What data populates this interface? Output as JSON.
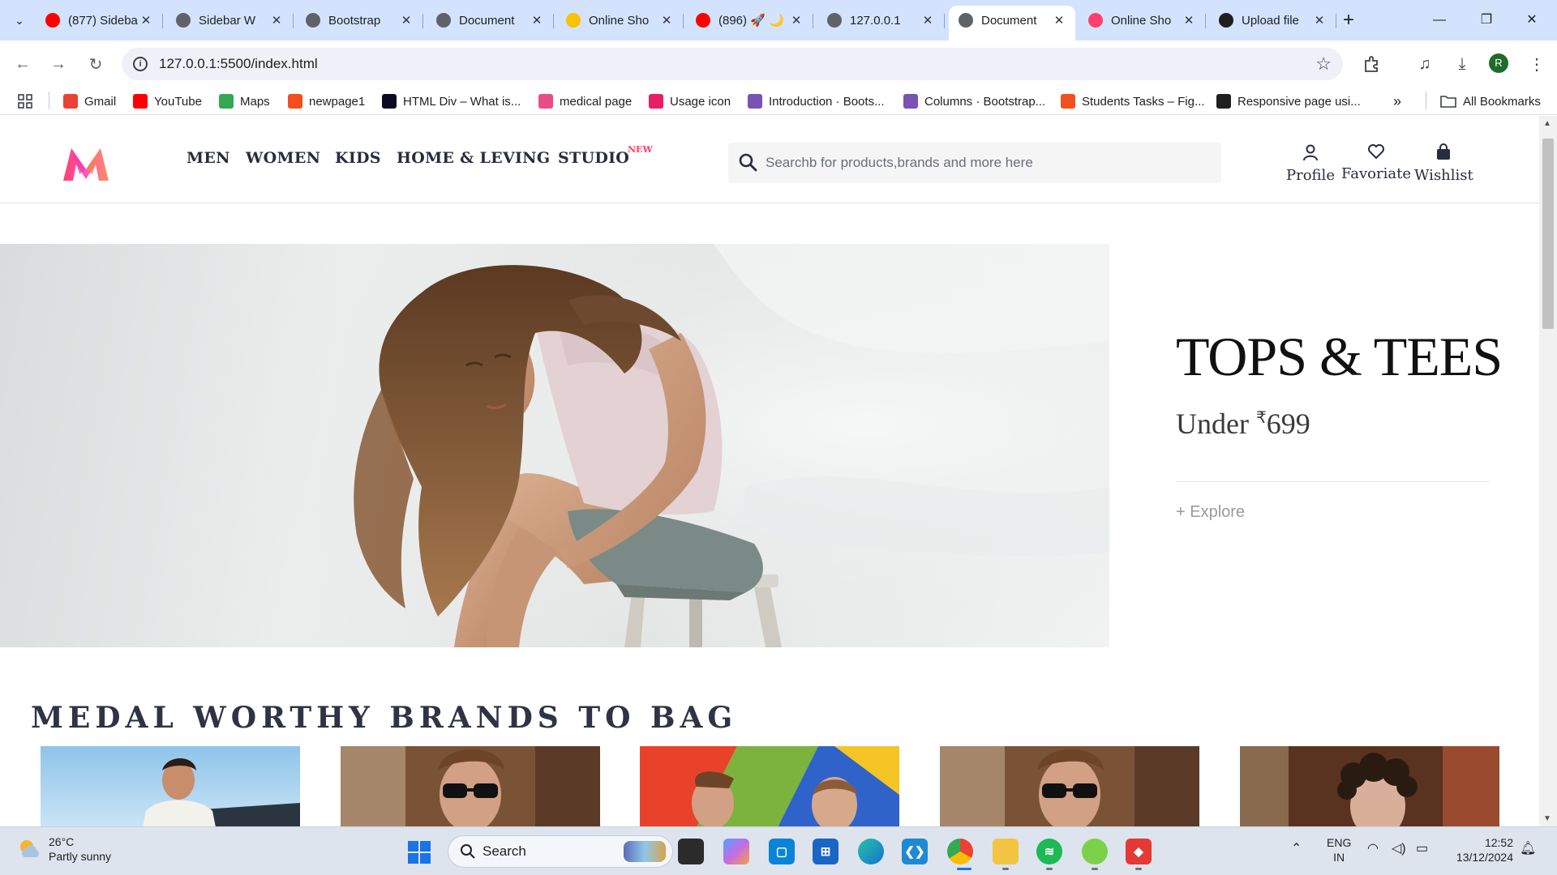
{
  "browser": {
    "tabs": [
      {
        "title": "(877) Sidebar",
        "favicon": "youtube-icon",
        "color": "#ff0000",
        "active": false
      },
      {
        "title": "Sidebar W",
        "favicon": "globe-icon",
        "color": "#5f6368",
        "active": false
      },
      {
        "title": "Bootstrap",
        "favicon": "globe-icon",
        "color": "#5f6368",
        "active": false
      },
      {
        "title": "Document",
        "favicon": "globe-icon",
        "color": "#5f6368",
        "active": false
      },
      {
        "title": "Online Sho",
        "favicon": "flipkart-icon",
        "color": "#f8c200",
        "active": false
      },
      {
        "title": "(896) 🚀 🌙",
        "favicon": "youtube-icon",
        "color": "#ff0000",
        "active": false
      },
      {
        "title": "127.0.0.1",
        "favicon": "globe-icon",
        "color": "#5f6368",
        "active": false
      },
      {
        "title": "Document",
        "favicon": "globe-icon",
        "color": "#5f6368",
        "active": true
      },
      {
        "title": "Online Sho",
        "favicon": "myntra-icon",
        "color": "#ff3f6c",
        "active": false
      },
      {
        "title": "Upload file",
        "favicon": "github-icon",
        "color": "#1f1f1f",
        "active": false
      }
    ],
    "url": "127.0.0.1:5500/index.html",
    "bookmarks": [
      {
        "label": "Gmail",
        "icon": "gmail-icon",
        "color": "#ea4335"
      },
      {
        "label": "YouTube",
        "icon": "youtube-icon",
        "color": "#ff0000"
      },
      {
        "label": "Maps",
        "icon": "maps-icon",
        "color": "#34a853"
      },
      {
        "label": "newpage1",
        "icon": "figma-icon",
        "color": "#f24e1e"
      },
      {
        "label": "HTML Div – What is...",
        "icon": "freecodecamp-icon",
        "color": "#0a0a23"
      },
      {
        "label": "medical page",
        "icon": "dribbble-icon",
        "color": "#ea4c89"
      },
      {
        "label": "Usage icon",
        "icon": "cube-icon",
        "color": "#e91e63"
      },
      {
        "label": "Introduction · Boots...",
        "icon": "bootstrap-icon",
        "color": "#7952b3"
      },
      {
        "label": "Columns · Bootstrap...",
        "icon": "bootstrap-icon",
        "color": "#7952b3"
      },
      {
        "label": "Students Tasks – Fig...",
        "icon": "figma-icon",
        "color": "#f24e1e"
      },
      {
        "label": "Responsive page usi...",
        "icon": "github-icon",
        "color": "#1f1f1f"
      }
    ],
    "all_bookmarks": "All Bookmarks"
  },
  "site": {
    "nav": [
      {
        "label": "MEN"
      },
      {
        "label": "WOMEN"
      },
      {
        "label": "KIDS"
      },
      {
        "label": "HOME & LEVING"
      },
      {
        "label": "STUDIO"
      }
    ],
    "new_tag": "NEW",
    "search_placeholder": "Searchb for products,brands and more here",
    "actions": [
      {
        "label": "Profile",
        "icon": "user-icon"
      },
      {
        "label": "Favoriate",
        "icon": "heart-icon"
      },
      {
        "label": "Wishlist",
        "icon": "bag-icon"
      }
    ],
    "hero": {
      "title": "TOPS & TEES",
      "sub_prefix": "Under ",
      "currency": "₹",
      "price": "699",
      "explore": "+ Explore"
    },
    "brands_title": "MEDAL WORTHY BRANDS TO BAG",
    "brand_cards": [
      {
        "icon": "brand-photo-man-car"
      },
      {
        "icon": "brand-photo-man-sunglasses"
      },
      {
        "icon": "brand-photo-two-men"
      },
      {
        "icon": "brand-photo-man-sunglasses"
      },
      {
        "icon": "brand-photo-curly-hair"
      }
    ],
    "accent": "#ff3f6c"
  },
  "taskbar": {
    "weather_temp": "26°C",
    "weather_desc": "Partly sunny",
    "search": "Search",
    "lang": "ENG",
    "region": "IN",
    "time": "12:52",
    "date": "13/12/2024"
  }
}
